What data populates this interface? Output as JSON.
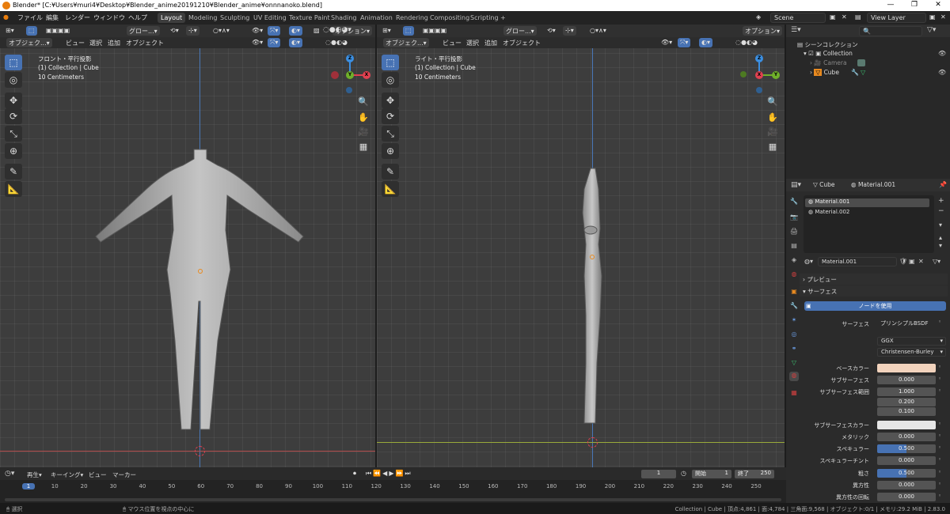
{
  "window": {
    "title": "Blender* [C:¥Users¥muri4¥Desktop¥Blender_anime20191210¥Blender_anime¥onnnanoko.blend]",
    "controls": [
      "—",
      "❐",
      "✕"
    ]
  },
  "topbar": {
    "menus": [
      "ファイル",
      "編集",
      "レンダー",
      "ウィンドウ",
      "ヘルプ"
    ],
    "workspaces": [
      "Layout",
      "Modeling",
      "Sculpting",
      "UV Editing",
      "Texture Paint",
      "Shading",
      "Animation",
      "Rendering",
      "Compositing",
      "Scripting",
      "+"
    ],
    "active_workspace": "Layout",
    "scene": "Scene",
    "view_layer": "View Layer"
  },
  "viewport_left": {
    "mode": "オブジェク...",
    "menus": [
      "ビュー",
      "選択",
      "追加",
      "オブジェクト"
    ],
    "transform_orientation": "グロー...",
    "options": "オプション",
    "overlay_line1": "フロント・平行投影",
    "overlay_line2": "(1) Collection | Cube",
    "overlay_line3": "10 Centimeters"
  },
  "viewport_right": {
    "mode": "オブジェク...",
    "menus": [
      "ビュー",
      "選択",
      "追加",
      "オブジェクト"
    ],
    "transform_orientation": "グロー...",
    "options": "オプション",
    "overlay_line1": "ライト・平行投影",
    "overlay_line2": "(1) Collection | Cube",
    "overlay_line3": "10 Centimeters"
  },
  "gizmo": {
    "z": "Z",
    "y": "Y",
    "x": "X"
  },
  "outliner": {
    "scene_collection": "シーンコレクション",
    "items": [
      "Collection",
      "Camera",
      "Cube"
    ]
  },
  "properties": {
    "object": "Cube",
    "material": "Material.001",
    "slots": [
      "Material.001",
      "Material.002"
    ],
    "slot_material": "Material.001",
    "preview_label": "プレビュー",
    "surface_section": "サーフェス",
    "use_nodes": "ノードを使用",
    "surface_label": "サーフェス",
    "surface_value": "プリンシプルBSDF",
    "distribution": "GGX",
    "subsurface_method": "Christensen-Burley",
    "rows": [
      {
        "label": "ベースカラー",
        "value": ""
      },
      {
        "label": "サブサーフェス",
        "value": "0.000"
      },
      {
        "label": "サブサーフェス範囲",
        "value": "1.000"
      },
      {
        "label": "",
        "value": "0.200"
      },
      {
        "label": "",
        "value": "0.100"
      },
      {
        "label": "サブサーフェスカラー",
        "value": ""
      },
      {
        "label": "メタリック",
        "value": "0.000"
      },
      {
        "label": "スペキュラー",
        "value": "0.500"
      },
      {
        "label": "スペキュラーチント",
        "value": "0.000"
      },
      {
        "label": "粗さ",
        "value": "0.500"
      },
      {
        "label": "異方性",
        "value": "0.000"
      },
      {
        "label": "異方性の回転",
        "value": "0.000"
      }
    ],
    "base_color": "#f2d3bd",
    "subsurface_color": "#e6e6e6"
  },
  "timeline": {
    "menus": [
      "再生",
      "キーイング",
      "ビュー",
      "マーカー"
    ],
    "current_frame": "1",
    "start_label": "開始",
    "start": "1",
    "end_label": "終了",
    "end": "250",
    "ticks": [
      "1",
      "10",
      "20",
      "30",
      "40",
      "50",
      "60",
      "70",
      "80",
      "90",
      "100",
      "110",
      "120",
      "130",
      "140",
      "150",
      "160",
      "170",
      "180",
      "190",
      "200",
      "210",
      "220",
      "230",
      "240",
      "250"
    ]
  },
  "statusbar": {
    "left1": "選択",
    "left2": "マウス位置を視点の中心に",
    "right": "Collection | Cube | 頂点:4,861 | 面:4,784 | 三角面:9,568 | オブジェクト:0/1 | メモリ:29.2 MiB | 2.83.0"
  },
  "colors": {
    "accent": "#4772b3",
    "x_axis": "#e04050",
    "y_axis": "#6fb02a",
    "z_axis": "#3b8ee0"
  }
}
